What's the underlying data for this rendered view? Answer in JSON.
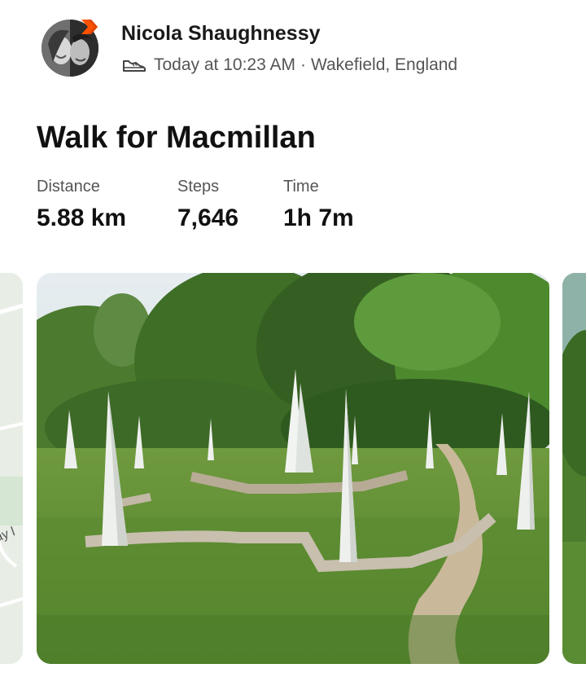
{
  "athlete": {
    "name": "Nicola Shaughnessy",
    "activity_type_icon": "shoe-icon",
    "time": "Today at 10:23 AM",
    "separator": "·",
    "location": "Wakefield, England"
  },
  "activity": {
    "title": "Walk for Macmillan"
  },
  "stats": [
    {
      "label": "Distance",
      "value": "5.88 km"
    },
    {
      "label": "Steps",
      "value": "7,646"
    },
    {
      "label": "Time",
      "value": "1h 7m"
    }
  ],
  "media": {
    "map_label_fragment": "ay l",
    "accent_color": "#fc5200"
  }
}
